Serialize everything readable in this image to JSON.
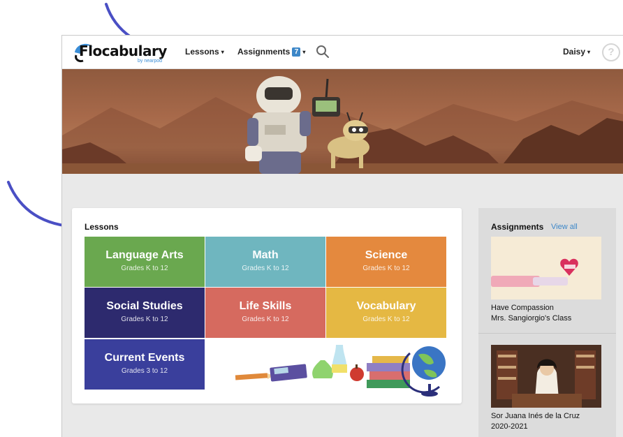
{
  "nav": {
    "logo_text": "Flocabulary",
    "logo_sub": "by nearpod",
    "lessons_label": "Lessons",
    "assignments_label": "Assignments",
    "assignments_count": "7",
    "user_name": "Daisy",
    "help_label": "?"
  },
  "lessons": {
    "title": "Lessons",
    "tiles": [
      {
        "title": "Language Arts",
        "grades": "Grades K to 12",
        "color": "#6aa84f"
      },
      {
        "title": "Math",
        "grades": "Grades K to 12",
        "color": "#6fb6bf"
      },
      {
        "title": "Science",
        "grades": "Grades K to 12",
        "color": "#e4893e"
      },
      {
        "title": "Social Studies",
        "grades": "Grades K to 12",
        "color": "#2d2a6e"
      },
      {
        "title": "Life Skills",
        "grades": "Grades K to 12",
        "color": "#d66a5f"
      },
      {
        "title": "Vocabulary",
        "grades": "Grades K to 12",
        "color": "#e5b843"
      },
      {
        "title": "Current Events",
        "grades": "Grades 3 to 12",
        "color": "#3a3f9c"
      }
    ]
  },
  "assignments": {
    "title": "Assignments",
    "view_all": "View all",
    "items": [
      {
        "name": "Have Compassion",
        "class": "Mrs. Sangiorgio's Class"
      },
      {
        "name": "Sor Juana Inés de la Cruz",
        "class": "2020-2021"
      }
    ]
  },
  "colors": {
    "accent": "#3d87c8",
    "arrow": "#4a4fc4"
  }
}
